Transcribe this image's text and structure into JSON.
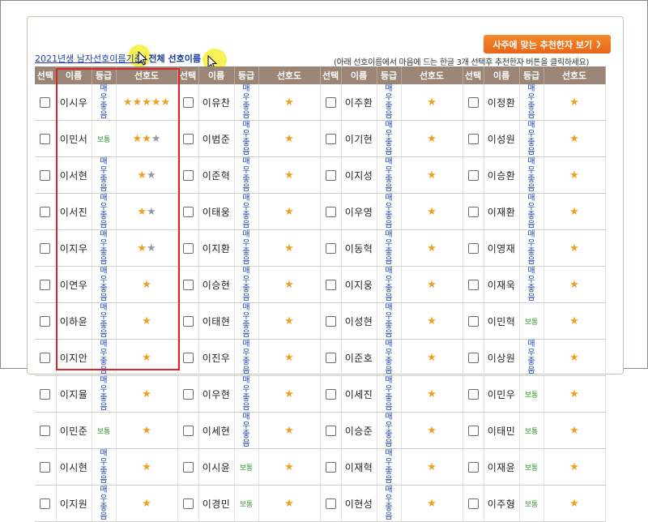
{
  "header": {
    "link1": "2021년생 남자선호이름기준",
    "link2": "전체 선호이름",
    "cta_label": "사주에 맞는 추천한자 보기",
    "note": "(아래 선호이름에서 마음에 드는 한글 3개 선택후 추천한자 버튼을 클릭하세요)"
  },
  "columns": {
    "select": "선택",
    "name": "이름",
    "grade": "등급",
    "preference": "선호도"
  },
  "grades": {
    "very": "매우좋음",
    "normal": "보통"
  },
  "groups": [
    {
      "rows": [
        {
          "name": "이시우",
          "grade": "very",
          "stars": 5,
          "grey": 0
        },
        {
          "name": "이민서",
          "grade": "normal",
          "stars": 2,
          "grey": 1
        },
        {
          "name": "이서현",
          "grade": "very",
          "stars": 1,
          "grey": 1
        },
        {
          "name": "이서진",
          "grade": "very",
          "stars": 1,
          "grey": 1
        },
        {
          "name": "이지우",
          "grade": "very",
          "stars": 1,
          "grey": 1
        },
        {
          "name": "이연우",
          "grade": "very",
          "stars": 1,
          "grey": 0
        },
        {
          "name": "이하윤",
          "grade": "very",
          "stars": 1,
          "grey": 0
        },
        {
          "name": "이지안",
          "grade": "very",
          "stars": 1,
          "grey": 0
        },
        {
          "name": "이지율",
          "grade": "very",
          "stars": 1,
          "grey": 0
        },
        {
          "name": "이민준",
          "grade": "normal",
          "stars": 1,
          "grey": 0
        },
        {
          "name": "이시현",
          "grade": "very",
          "stars": 1,
          "grey": 0
        },
        {
          "name": "이지원",
          "grade": "very",
          "stars": 1,
          "grey": 0
        }
      ]
    },
    {
      "rows": [
        {
          "name": "이유찬",
          "grade": "very",
          "stars": 0,
          "grey": 1
        },
        {
          "name": "이범준",
          "grade": "very",
          "stars": 0,
          "grey": 1
        },
        {
          "name": "이준혁",
          "grade": "very",
          "stars": 0,
          "grey": 1
        },
        {
          "name": "이태웅",
          "grade": "very",
          "stars": 0,
          "grey": 1
        },
        {
          "name": "이지환",
          "grade": "very",
          "stars": 0,
          "grey": 1
        },
        {
          "name": "이승현",
          "grade": "very",
          "stars": 0,
          "grey": 1
        },
        {
          "name": "이태현",
          "grade": "very",
          "stars": 0,
          "grey": 1
        },
        {
          "name": "이진우",
          "grade": "very",
          "stars": 0,
          "grey": 1
        },
        {
          "name": "이우현",
          "grade": "very",
          "stars": 0,
          "grey": 1
        },
        {
          "name": "이세현",
          "grade": "very",
          "stars": 0,
          "grey": 1
        },
        {
          "name": "이시윤",
          "grade": "normal",
          "stars": 0,
          "grey": 1
        },
        {
          "name": "이경민",
          "grade": "normal",
          "stars": 0,
          "grey": 1
        }
      ]
    },
    {
      "rows": [
        {
          "name": "이주환",
          "grade": "very",
          "stars": 0,
          "grey": 1
        },
        {
          "name": "이기현",
          "grade": "very",
          "stars": 0,
          "grey": 1
        },
        {
          "name": "이지성",
          "grade": "very",
          "stars": 0,
          "grey": 1
        },
        {
          "name": "이우영",
          "grade": "very",
          "stars": 0,
          "grey": 1
        },
        {
          "name": "이동혁",
          "grade": "very",
          "stars": 0,
          "grey": 1
        },
        {
          "name": "이지웅",
          "grade": "very",
          "stars": 0,
          "grey": 1
        },
        {
          "name": "이성현",
          "grade": "very",
          "stars": 0,
          "grey": 1
        },
        {
          "name": "이준호",
          "grade": "very",
          "stars": 0,
          "grey": 1
        },
        {
          "name": "이세진",
          "grade": "very",
          "stars": 0,
          "grey": 1
        },
        {
          "name": "이승준",
          "grade": "very",
          "stars": 0,
          "grey": 1
        },
        {
          "name": "이재혁",
          "grade": "very",
          "stars": 0,
          "grey": 1
        },
        {
          "name": "이현성",
          "grade": "very",
          "stars": 0,
          "grey": 1
        }
      ]
    },
    {
      "rows": [
        {
          "name": "이정환",
          "grade": "very",
          "stars": 0,
          "grey": 1
        },
        {
          "name": "이성원",
          "grade": "very",
          "stars": 0,
          "grey": 1
        },
        {
          "name": "이승환",
          "grade": "very",
          "stars": 0,
          "grey": 1
        },
        {
          "name": "이재환",
          "grade": "very",
          "stars": 0,
          "grey": 1
        },
        {
          "name": "이영재",
          "grade": "very",
          "stars": 0,
          "grey": 1
        },
        {
          "name": "이재욱",
          "grade": "very",
          "stars": 0,
          "grey": 1
        },
        {
          "name": "이민혁",
          "grade": "normal",
          "stars": 0,
          "grey": 1
        },
        {
          "name": "이상원",
          "grade": "very",
          "stars": 0,
          "grey": 1
        },
        {
          "name": "이민우",
          "grade": "normal",
          "stars": 0,
          "grey": 1
        },
        {
          "name": "이태민",
          "grade": "normal",
          "stars": 0,
          "grey": 1
        },
        {
          "name": "이재윤",
          "grade": "normal",
          "stars": 0,
          "grey": 1
        },
        {
          "name": "이주형",
          "grade": "normal",
          "stars": 0,
          "grey": 1
        }
      ]
    }
  ]
}
